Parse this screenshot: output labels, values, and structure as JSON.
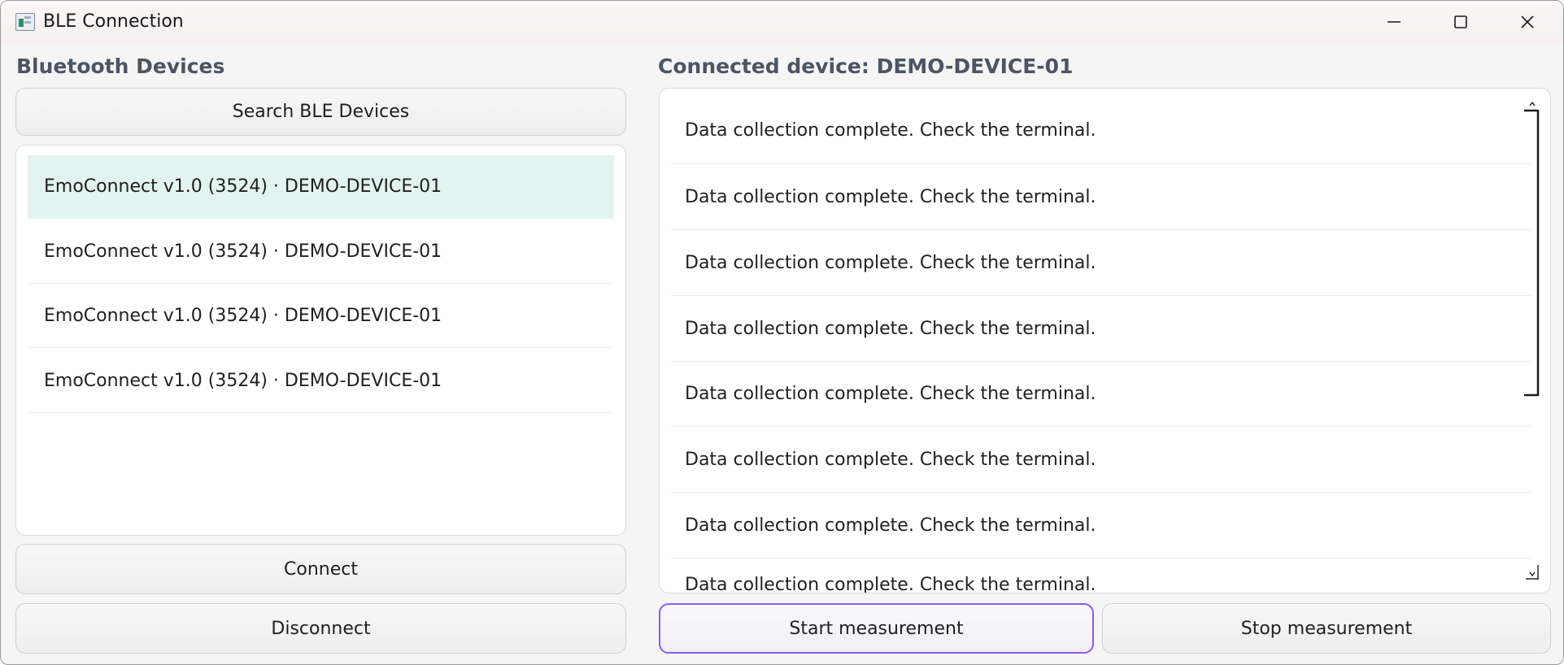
{
  "window": {
    "title": "BLE Connection",
    "controls": [
      "minimize-icon",
      "maximize-icon",
      "close-icon"
    ]
  },
  "left": {
    "heading": "Bluetooth Devices",
    "search_button": "Search BLE Devices",
    "devices": [
      {
        "label": "EmoConnect v1.0 (3524) · DEMO-DEVICE-01",
        "selected": true
      },
      {
        "label": "EmoConnect v1.0 (3524) · DEMO-DEVICE-01",
        "selected": false
      },
      {
        "label": "EmoConnect v1.0 (3524) · DEMO-DEVICE-01",
        "selected": false
      },
      {
        "label": "EmoConnect v1.0 (3524) · DEMO-DEVICE-01",
        "selected": false
      }
    ],
    "connect_button": "Connect",
    "disconnect_button": "Disconnect"
  },
  "right": {
    "heading": "Connected device: DEMO-DEVICE-01",
    "log": [
      "Data collection complete. Check the terminal.",
      "Data collection complete. Check the terminal.",
      "Data collection complete. Check the terminal.",
      "Data collection complete. Check the terminal.",
      "Data collection complete. Check the terminal.",
      "Data collection complete. Check the terminal.",
      "Data collection complete. Check the terminal.",
      "Data collection complete. Check the terminal."
    ],
    "start_button": "Start measurement",
    "stop_button": "Stop measurement"
  },
  "colors": {
    "selected_row": "#e3f3ef",
    "primary_border": "#8a5cf0",
    "heading": "#4b5563"
  }
}
